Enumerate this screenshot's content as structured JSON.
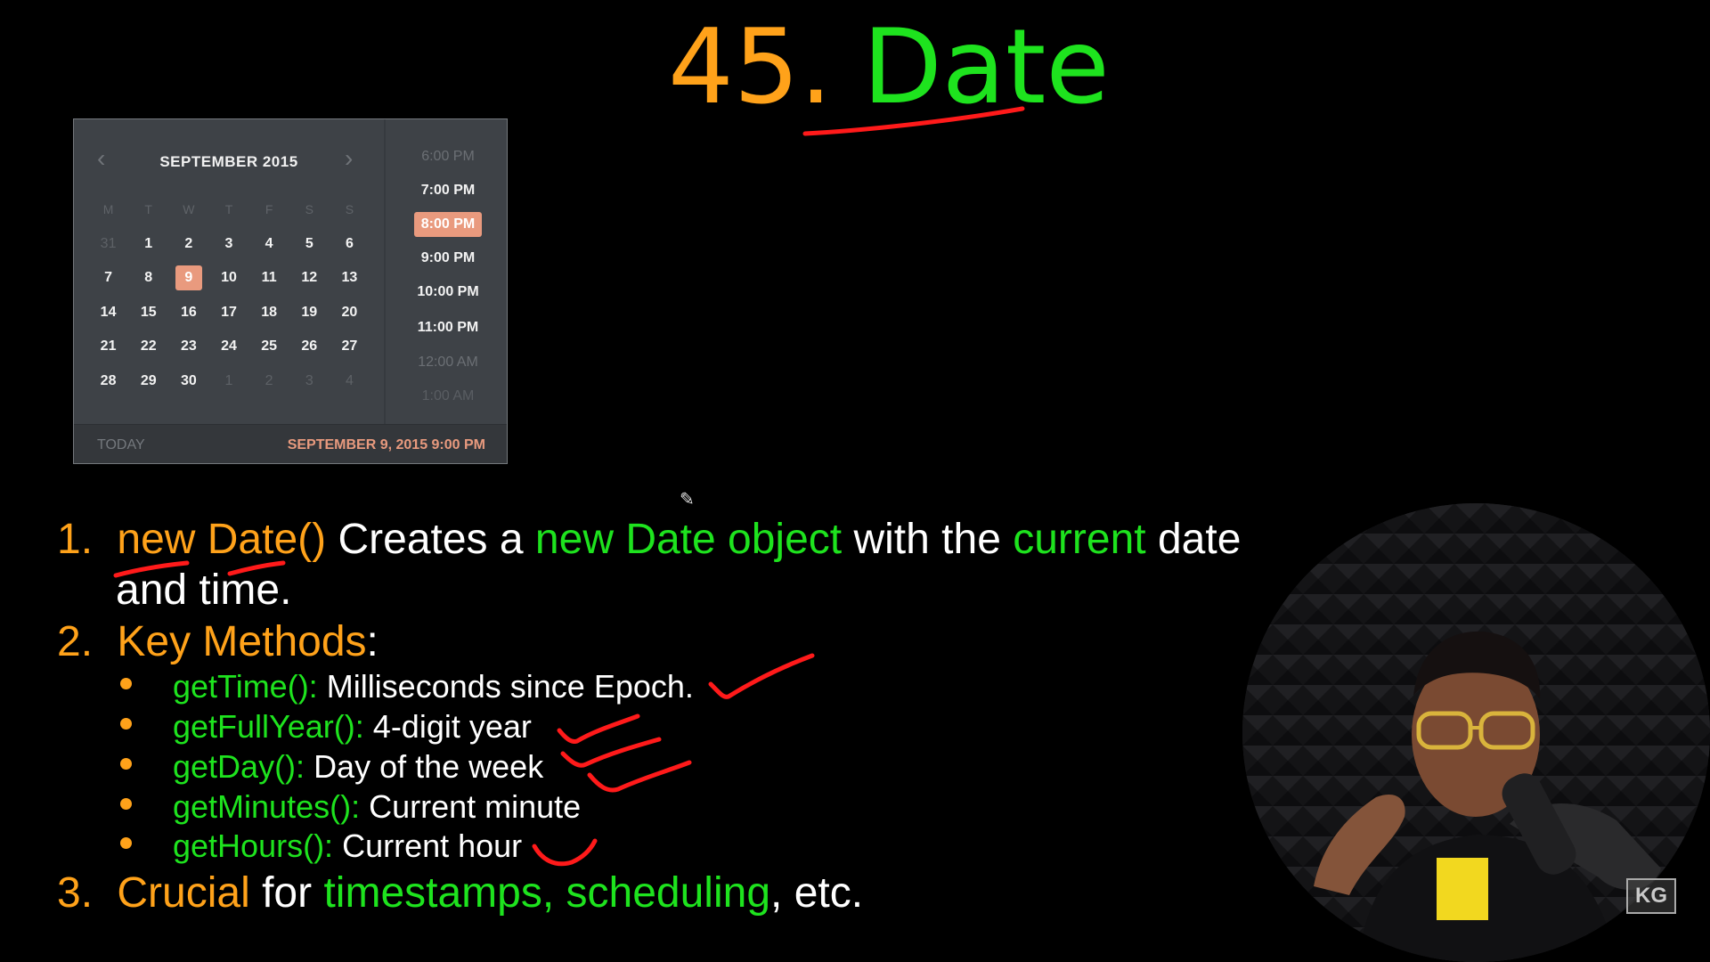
{
  "title": {
    "number": "45.",
    "word": "Date"
  },
  "calendar": {
    "month": "SEPTEMBER 2015",
    "weekdays": [
      "M",
      "T",
      "W",
      "T",
      "F",
      "S",
      "S"
    ],
    "weeks": [
      [
        "31",
        "1",
        "2",
        "3",
        "4",
        "5",
        "6"
      ],
      [
        "7",
        "8",
        "9",
        "10",
        "11",
        "12",
        "13"
      ],
      [
        "14",
        "15",
        "16",
        "17",
        "18",
        "19",
        "20"
      ],
      [
        "21",
        "22",
        "23",
        "24",
        "25",
        "26",
        "27"
      ],
      [
        "28",
        "29",
        "30",
        "1",
        "2",
        "3",
        "4"
      ]
    ],
    "selected_day": "9",
    "times": [
      "6:00  PM",
      "7:00  PM",
      "8:00  PM",
      "9:00  PM",
      "10:00  PM",
      "11:00  PM",
      "12:00  AM",
      "1:00  AM"
    ],
    "selected_time": "8:00  PM",
    "today_label": "TODAY",
    "selected_datetime": "SEPTEMBER 9, 2015 9:00 PM"
  },
  "notes": {
    "item1": {
      "num": "1.",
      "code": "new Date()",
      "t1": "Creates a",
      "hl1": "new Date object",
      "t2": "with the",
      "hl2": "current",
      "t3": "date",
      "cont": "and time."
    },
    "item2": {
      "num": "2.",
      "label": "Key Methods",
      "colon": ":"
    },
    "methods": [
      {
        "name": "getTime():",
        "desc": "Milliseconds since Epoch."
      },
      {
        "name": "getFullYear():",
        "desc": "4-digit year"
      },
      {
        "name": "getDay():",
        "desc": "Day of the week"
      },
      {
        "name": "getMinutes():",
        "desc": "Current minute"
      },
      {
        "name": "getHours():",
        "desc": "Current hour"
      }
    ],
    "item3": {
      "num": "3.",
      "label": "Crucial",
      "t1": "for",
      "hl": "timestamps, scheduling",
      "t2": ", etc."
    }
  },
  "channel_logo": "KG",
  "colors": {
    "orange": "#ffa21a",
    "green": "#1ee31e",
    "red_ink": "#ff1a1a",
    "calendar_accent": "#e99a7e"
  }
}
